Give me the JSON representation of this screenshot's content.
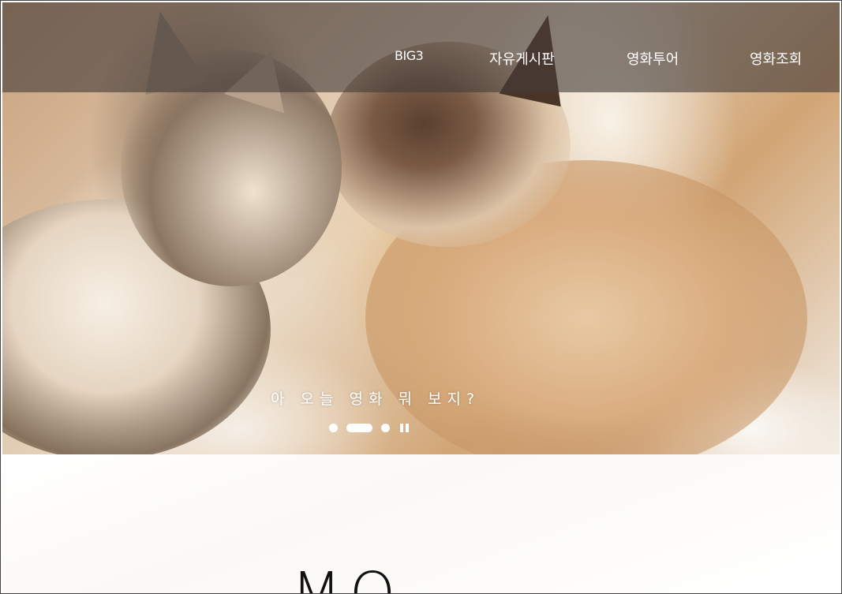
{
  "nav": {
    "items": [
      {
        "label": "BIG3"
      },
      {
        "label": "자유게시판"
      },
      {
        "label": "영화투어"
      },
      {
        "label": "영화조회"
      }
    ]
  },
  "hero": {
    "caption": "아 오늘 영화 뭐 보지?",
    "slides": {
      "total": 3,
      "active": 2
    },
    "pause_icon": "pause-icon"
  },
  "section": {
    "title_partial": "MO"
  }
}
